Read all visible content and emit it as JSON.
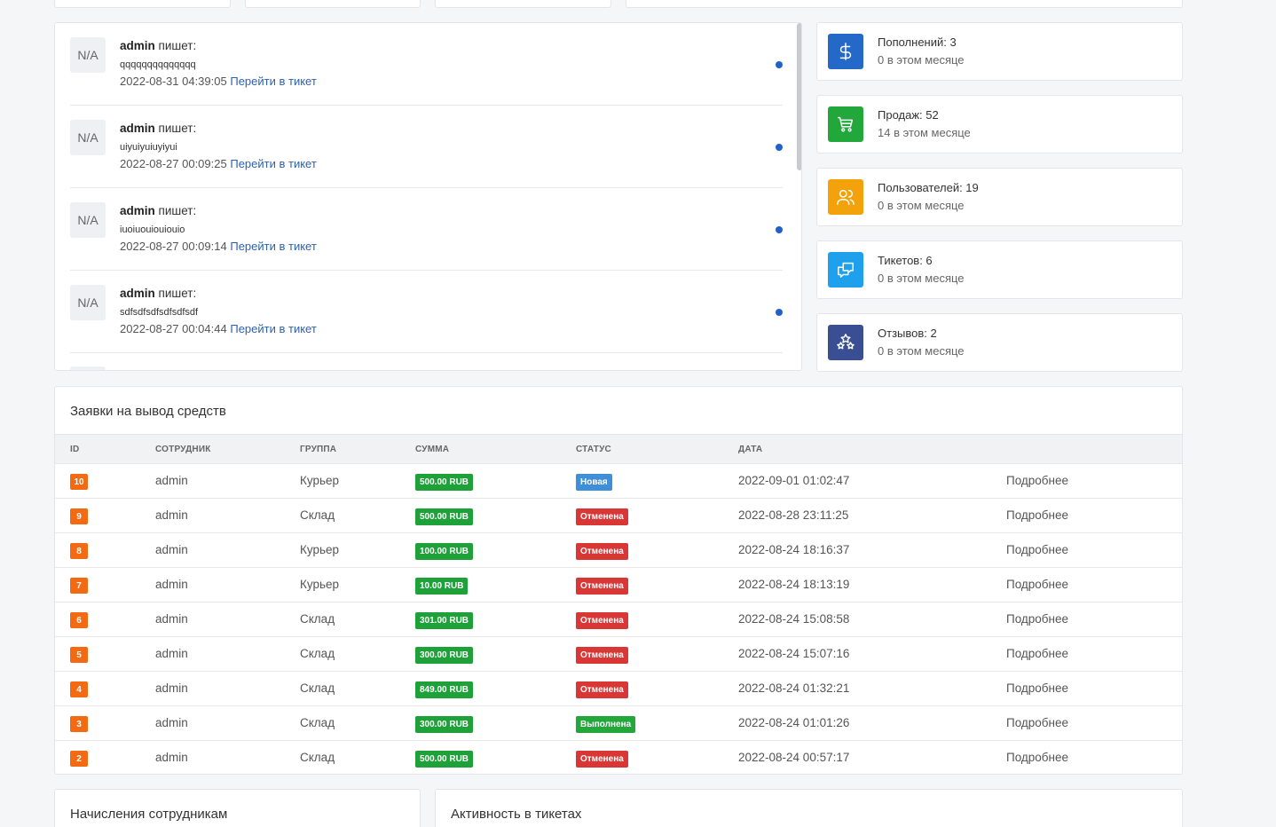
{
  "messages": [
    {
      "avatar": "N/A",
      "author": "admin",
      "verb": "пишет:",
      "text": "qqqqqqqqqqqqqq",
      "datetime": "2022-08-31 04:39:05",
      "link": "Перейти в тикет"
    },
    {
      "avatar": "N/A",
      "author": "admin",
      "verb": "пишет:",
      "text": "uiyuiyuiuyiyui",
      "datetime": "2022-08-27 00:09:25",
      "link": "Перейти в тикет"
    },
    {
      "avatar": "N/A",
      "author": "admin",
      "verb": "пишет:",
      "text": "iuoiuouiouiouio",
      "datetime": "2022-08-27 00:09:14",
      "link": "Перейти в тикет"
    },
    {
      "avatar": "N/A",
      "author": "admin",
      "verb": "пишет:",
      "text": "sdfsdfsdfsdfsdfsdf",
      "datetime": "2022-08-27 00:04:44",
      "link": "Перейти в тикет"
    }
  ],
  "stats": [
    {
      "icon": "dollar-icon",
      "color": "#2469c8",
      "title": "Пополнений: 3",
      "sub": "0 в этом месяце"
    },
    {
      "icon": "cart-icon",
      "color": "#22a83a",
      "title": "Продаж: 52",
      "sub": "14 в этом месяце"
    },
    {
      "icon": "users-icon",
      "color": "#f4a20c",
      "title": "Пользователей: 19",
      "sub": "0 в этом месяце"
    },
    {
      "icon": "chat-icon",
      "color": "#1ea0ec",
      "title": "Тикетов: 6",
      "sub": "0 в этом месяце"
    },
    {
      "icon": "stars-icon",
      "color": "#3a4f93",
      "title": "Отзывов: 2",
      "sub": "0 в этом месяце"
    }
  ],
  "withdrawals": {
    "title": "Заявки на вывод средств",
    "headers": {
      "id": "ID",
      "employee": "СОТРУДНИК",
      "group": "ГРУППА",
      "sum": "СУММА",
      "status": "СТАТУС",
      "date": "ДАТА"
    },
    "status_colors": {
      "Новая": "#3f8fd8",
      "Отменена": "#d93636",
      "Выполнена": "#22a83a"
    },
    "rows": [
      {
        "id": "10",
        "employee": "admin",
        "group": "Курьер",
        "sum": "500.00 RUB",
        "status": "Новая",
        "date": "2022-09-01 01:02:47",
        "action": "Подробнее"
      },
      {
        "id": "9",
        "employee": "admin",
        "group": "Склад",
        "sum": "500.00 RUB",
        "status": "Отменена",
        "date": "2022-08-28 23:11:25",
        "action": "Подробнее"
      },
      {
        "id": "8",
        "employee": "admin",
        "group": "Курьер",
        "sum": "100.00 RUB",
        "status": "Отменена",
        "date": "2022-08-24 18:16:37",
        "action": "Подробнее"
      },
      {
        "id": "7",
        "employee": "admin",
        "group": "Курьер",
        "sum": "10.00 RUB",
        "status": "Отменена",
        "date": "2022-08-24 18:13:19",
        "action": "Подробнее"
      },
      {
        "id": "6",
        "employee": "admin",
        "group": "Склад",
        "sum": "301.00 RUB",
        "status": "Отменена",
        "date": "2022-08-24 15:08:58",
        "action": "Подробнее"
      },
      {
        "id": "5",
        "employee": "admin",
        "group": "Склад",
        "sum": "300.00 RUB",
        "status": "Отменена",
        "date": "2022-08-24 15:07:16",
        "action": "Подробнее"
      },
      {
        "id": "4",
        "employee": "admin",
        "group": "Склад",
        "sum": "849.00 RUB",
        "status": "Отменена",
        "date": "2022-08-24 01:32:21",
        "action": "Подробнее"
      },
      {
        "id": "3",
        "employee": "admin",
        "group": "Склад",
        "sum": "300.00 RUB",
        "status": "Выполнена",
        "date": "2022-08-24 01:01:26",
        "action": "Подробнее"
      },
      {
        "id": "2",
        "employee": "admin",
        "group": "Склад",
        "sum": "500.00 RUB",
        "status": "Отменена",
        "date": "2022-08-24 00:57:17",
        "action": "Подробнее"
      }
    ]
  },
  "accruals": {
    "title": "Начисления сотрудникам"
  },
  "activity": {
    "title": "Активность в тикетах"
  }
}
